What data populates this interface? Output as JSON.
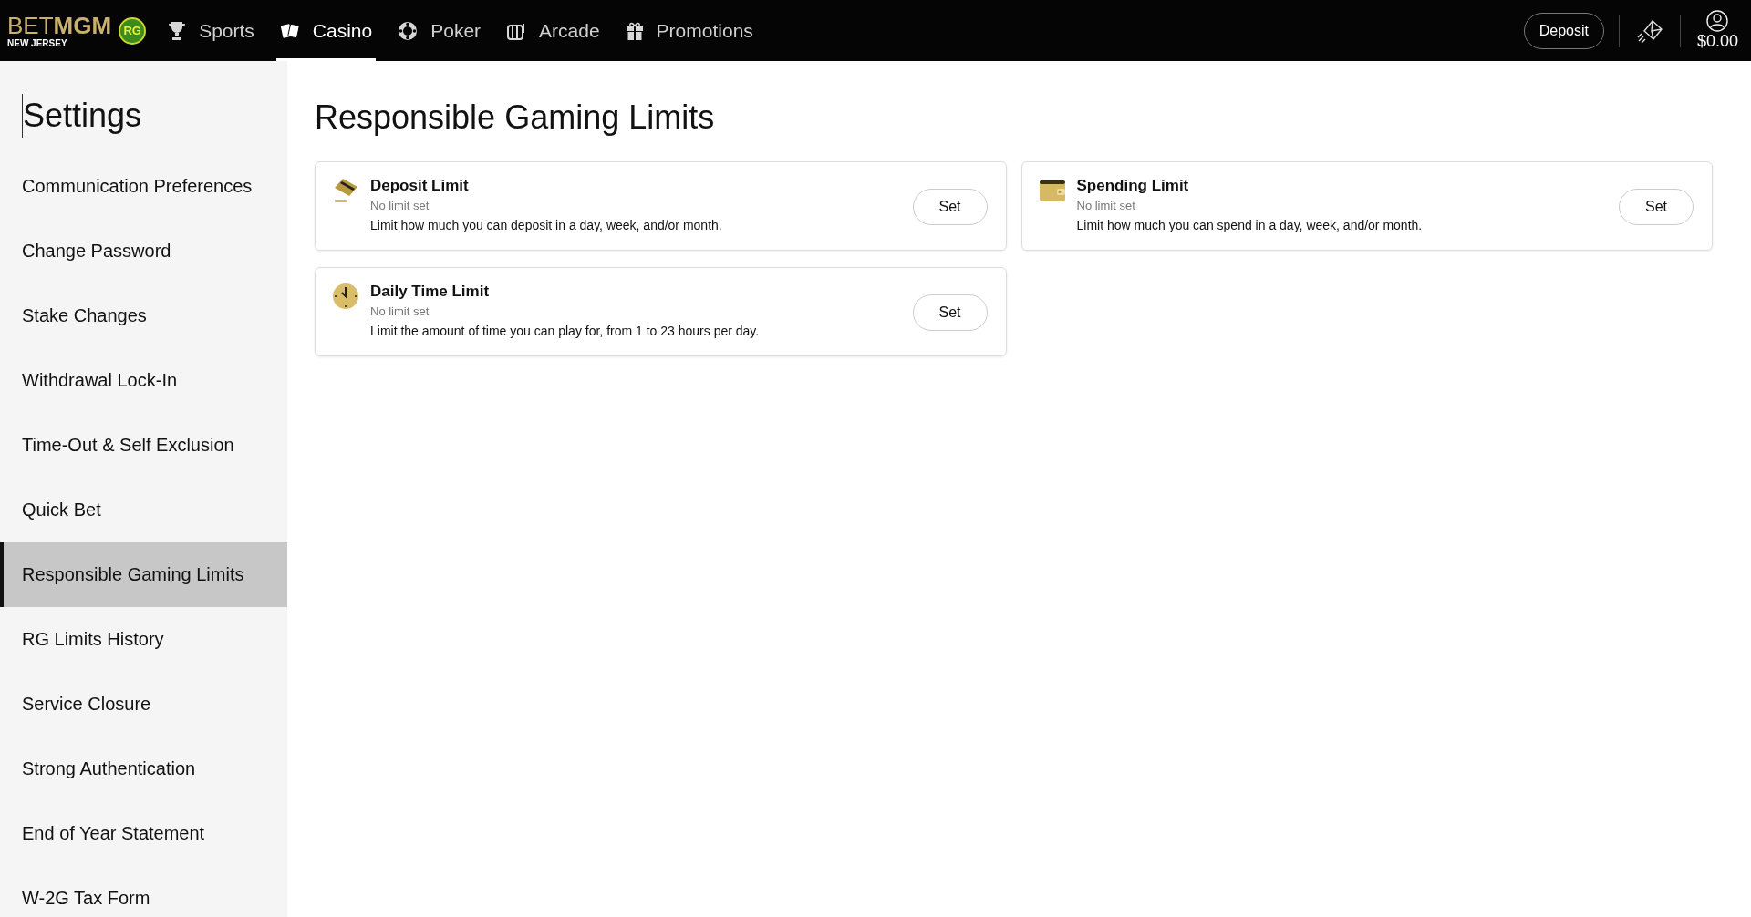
{
  "header": {
    "logo": {
      "light": "BET",
      "bold": "MGM",
      "region": "NEW JERSEY",
      "badge": "RG"
    },
    "nav": [
      {
        "label": "Sports",
        "kind": "trophy",
        "selected": false
      },
      {
        "label": "Casino",
        "kind": "cards",
        "selected": true
      },
      {
        "label": "Poker",
        "kind": "chip",
        "selected": false
      },
      {
        "label": "Arcade",
        "kind": "slot",
        "selected": false
      },
      {
        "label": "Promotions",
        "kind": "gift",
        "selected": false
      }
    ],
    "deposit_button": "Deposit",
    "balance": "$0.00"
  },
  "sidebar": {
    "title": "Settings",
    "items": [
      {
        "label": "Communication Preferences",
        "selected": false
      },
      {
        "label": "Change Password",
        "selected": false
      },
      {
        "label": "Stake Changes",
        "selected": false
      },
      {
        "label": "Withdrawal Lock-In",
        "selected": false
      },
      {
        "label": "Time-Out & Self Exclusion",
        "selected": false
      },
      {
        "label": "Quick Bet",
        "selected": false
      },
      {
        "label": "Responsible Gaming Limits",
        "selected": true
      },
      {
        "label": "RG Limits History",
        "selected": false
      },
      {
        "label": "Service Closure",
        "selected": false
      },
      {
        "label": "Strong Authentication",
        "selected": false
      },
      {
        "label": "End of Year Statement",
        "selected": false
      },
      {
        "label": "W-2G Tax Form",
        "selected": false
      }
    ]
  },
  "main": {
    "title": "Responsible Gaming Limits",
    "cards": [
      {
        "kind": "card",
        "title": "Deposit Limit",
        "status": "No limit set",
        "description": "Limit how much you can deposit in a day, week, and/or month.",
        "button": "Set"
      },
      {
        "kind": "wallet",
        "title": "Spending Limit",
        "status": "No limit set",
        "description": "Limit how much you can spend in a day, week, and/or month.",
        "button": "Set"
      },
      {
        "kind": "clock",
        "title": "Daily Time Limit",
        "status": "No limit set",
        "description": "Limit the amount of time you can play for, from 1 to 23 hours per day.",
        "button": "Set"
      }
    ]
  }
}
